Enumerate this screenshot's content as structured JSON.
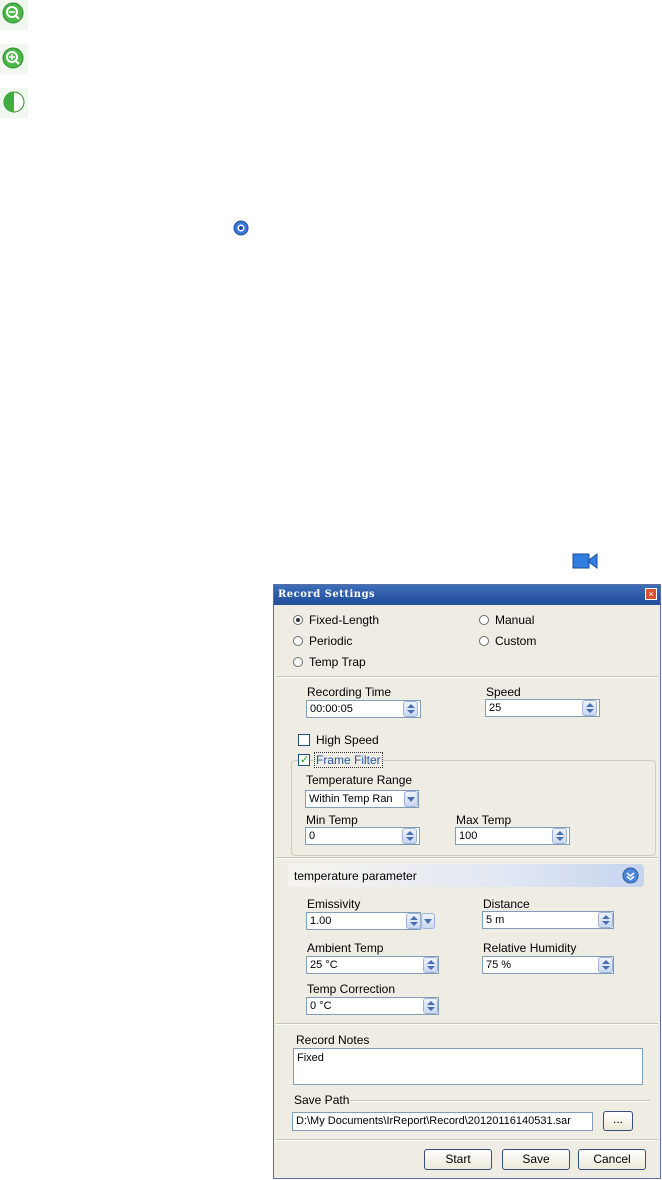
{
  "dialog": {
    "title": "Record Settings",
    "close_glyph": "×",
    "modes": {
      "fixed_length": "Fixed-Length",
      "manual": "Manual",
      "periodic": "Periodic",
      "custom": "Custom",
      "temp_trap": "Temp Trap",
      "selected": "fixed_length"
    },
    "recording_time": {
      "label": "Recording Time",
      "value": "00:00:05"
    },
    "speed": {
      "label": "Speed",
      "value": "25"
    },
    "high_speed": {
      "label": "High Speed",
      "checked": false
    },
    "frame_filter": {
      "label": "Frame Filter",
      "checked": true,
      "temperature_range_label": "Temperature Range",
      "temperature_range_value": "Within Temp Ran",
      "min_temp_label": "Min Temp",
      "min_temp_value": "0",
      "max_temp_label": "Max Temp",
      "max_temp_value": "100"
    },
    "temperature_parameter": {
      "header": "temperature parameter",
      "emissivity_label": "Emissivity",
      "emissivity_value": "1.00",
      "distance_label": "Distance",
      "distance_value": "5 m",
      "ambient_label": "Ambient Temp",
      "ambient_value": "25 °C",
      "humidity_label": "Relative Humidity",
      "humidity_value": "75 %",
      "correction_label": "Temp Correction",
      "correction_value": "0 °C"
    },
    "record_notes": {
      "label": "Record Notes",
      "value": "Fixed"
    },
    "save_path": {
      "label": "Save Path",
      "value": "D:\\My Documents\\IrReport\\Record\\20120116140531.sar",
      "browse_label": "..."
    },
    "buttons": {
      "start": "Start",
      "save": "Save",
      "cancel": "Cancel"
    }
  },
  "icons": [
    "zoom-out-icon",
    "zoom-in-icon",
    "half-circle-icon",
    "settings-gear-icon",
    "video-camera-icon"
  ],
  "colors": {
    "title_bar": "#2a57a6",
    "dialog_bg": "#efece3",
    "icon_green": "#3fae3f"
  }
}
